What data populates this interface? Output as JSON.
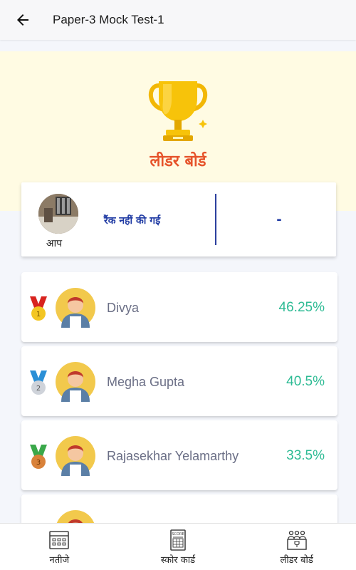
{
  "header": {
    "title": "Paper-3 Mock Test-1"
  },
  "hero": {
    "title": "लीडर बोर्ड"
  },
  "you": {
    "label": "आप",
    "rank_text": "रैंक नहीं की गई",
    "score": "-"
  },
  "leaderboard": [
    {
      "rank": "1",
      "name": "Divya",
      "score": "46.25%",
      "ribbon": "#d8231e",
      "medal": "#f3c623"
    },
    {
      "rank": "2",
      "name": "Megha Gupta",
      "score": "40.5%",
      "ribbon": "#2b8fd6",
      "medal": "#cfd3da"
    },
    {
      "rank": "3",
      "name": "Rajasekhar Yelamarthy",
      "score": "33.5%",
      "ribbon": "#3aa84a",
      "medal": "#d9823a"
    }
  ],
  "nav": {
    "results": "नतीजे",
    "scorecard": "स्कोर कार्ड",
    "leaderboard": "लीडर बोर्ड",
    "scorecard_icon_text": "SCORE"
  },
  "colors": {
    "accent_title": "#e6532a",
    "rank_blue": "#1f3aa3",
    "score_green": "#2dbb94",
    "hero_bg": "#fffbe3"
  },
  "icons": [
    "back-arrow-icon",
    "trophy-icon",
    "medal-icon",
    "results-grid-icon",
    "scorecard-icon",
    "leaderboard-people-icon"
  ]
}
